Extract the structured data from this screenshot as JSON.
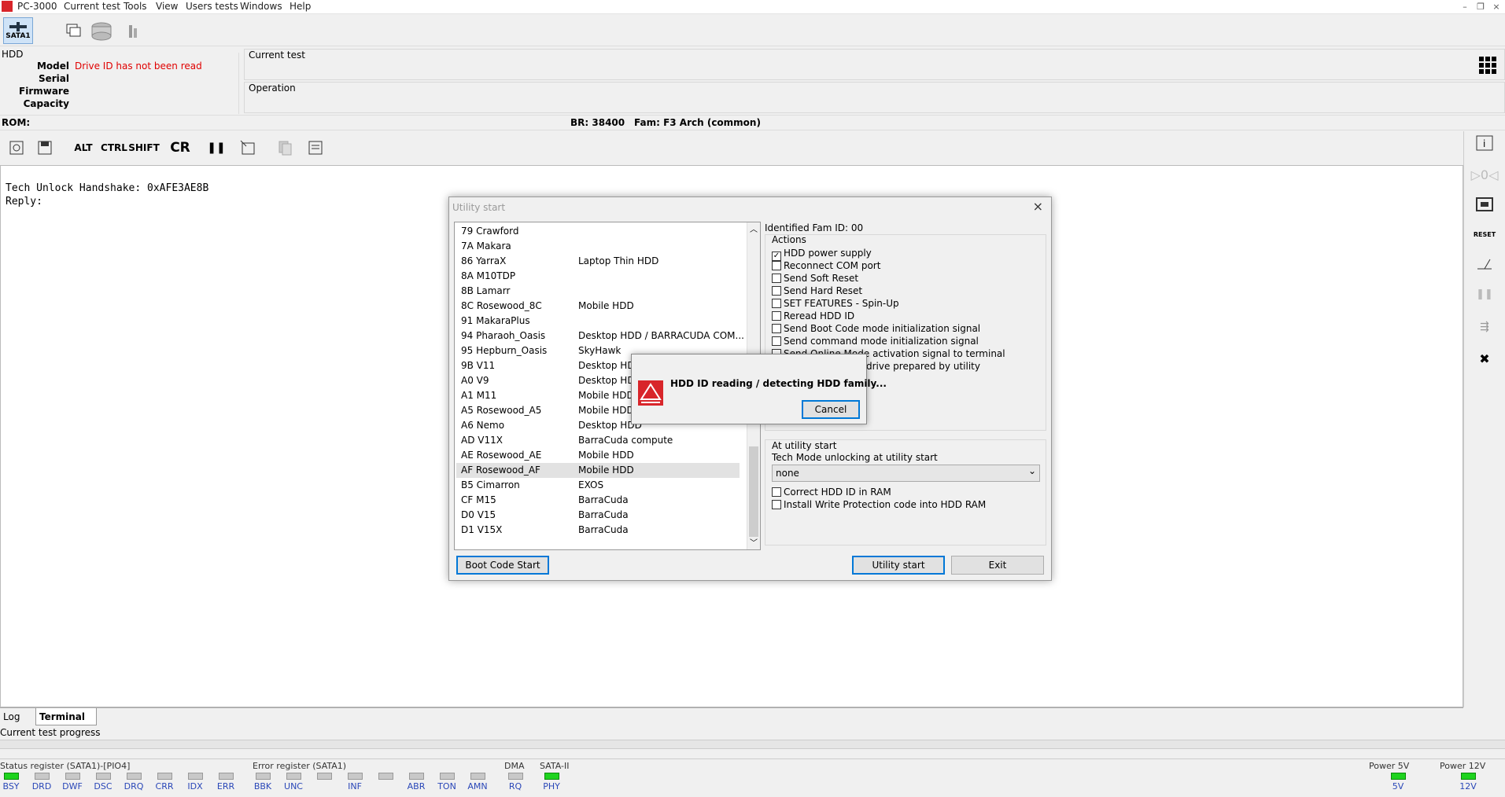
{
  "menubar": {
    "app": "PC-3000",
    "items": [
      "Current test",
      "Tools",
      "View",
      "Users tests",
      "Windows",
      "Help"
    ]
  },
  "toolbar": {
    "port_label": "SATA1"
  },
  "hdd": {
    "panel_title": "HDD",
    "model_label": "Model",
    "model_value": "Drive ID has not been read",
    "serial_label": "Serial",
    "firmware_label": "Firmware",
    "capacity_label": "Capacity"
  },
  "current_test": {
    "label": "Current test",
    "operation_label": "Operation"
  },
  "rombar": {
    "rom": "ROM:",
    "br": "BR: 38400",
    "fam": "Fam: F3 Arch (common)"
  },
  "terminal_toolbar": {
    "alt": "ALT",
    "ctrl": "CTRL",
    "shift": "SHIFT",
    "cr": "CR"
  },
  "terminal": {
    "lines": [
      "Tech Unlock Handshake: 0xAFE3AE8B",
      "Reply:"
    ]
  },
  "tabs": {
    "log": "Log",
    "terminal": "Terminal"
  },
  "progress": {
    "label": "Current test progress"
  },
  "status": {
    "status_register": {
      "title": "Status register (SATA1)-[PIO4]",
      "leds": [
        {
          "name": "BSY",
          "on": true
        },
        {
          "name": "DRD",
          "on": false
        },
        {
          "name": "DWF",
          "on": false
        },
        {
          "name": "DSC",
          "on": false
        },
        {
          "name": "DRQ",
          "on": false
        },
        {
          "name": "CRR",
          "on": false
        },
        {
          "name": "IDX",
          "on": false
        },
        {
          "name": "ERR",
          "on": false
        }
      ]
    },
    "error_register": {
      "title": "Error register (SATA1)",
      "leds": [
        {
          "name": "BBK",
          "on": false
        },
        {
          "name": "UNC",
          "on": false
        },
        {
          "name": "",
          "on": false
        },
        {
          "name": "INF",
          "on": false
        },
        {
          "name": "",
          "on": false
        },
        {
          "name": "ABR",
          "on": false
        },
        {
          "name": "TON",
          "on": false
        },
        {
          "name": "AMN",
          "on": false
        }
      ]
    },
    "dma": {
      "title": "DMA",
      "leds": [
        {
          "name": "RQ",
          "on": false
        }
      ]
    },
    "sata": {
      "title": "SATA-II",
      "leds": [
        {
          "name": "PHY",
          "on": true
        }
      ]
    },
    "power5": {
      "title": "Power 5V",
      "name": "5V",
      "on": true
    },
    "power12": {
      "title": "Power 12V",
      "name": "12V",
      "on": true
    }
  },
  "dialog": {
    "title": "Utility start",
    "families": [
      {
        "id": "79 Crawford",
        "desc": ""
      },
      {
        "id": "7A Makara",
        "desc": ""
      },
      {
        "id": "86 YarraX",
        "desc": "Laptop Thin HDD"
      },
      {
        "id": "8A M10TDP",
        "desc": ""
      },
      {
        "id": "8B Lamarr",
        "desc": ""
      },
      {
        "id": "8C Rosewood_8C",
        "desc": "Mobile HDD"
      },
      {
        "id": "91 MakaraPlus",
        "desc": ""
      },
      {
        "id": "94 Pharaoh_Oasis",
        "desc": "Desktop HDD / BARRACUDA COM..."
      },
      {
        "id": "95 Hepburn_Oasis",
        "desc": "SkyHawk"
      },
      {
        "id": "9B V11",
        "desc": "Desktop HDD"
      },
      {
        "id": "A0 V9",
        "desc": "Desktop HDD"
      },
      {
        "id": "A1 M11",
        "desc": "Mobile HDD"
      },
      {
        "id": "A5 Rosewood_A5",
        "desc": "Mobile HDD"
      },
      {
        "id": "A6 Nemo",
        "desc": "Desktop HDD"
      },
      {
        "id": "AD V11X",
        "desc": "BarraCuda compute"
      },
      {
        "id": "AE Rosewood_AE",
        "desc": "Mobile HDD"
      },
      {
        "id": "AF Rosewood_AF",
        "desc": "Mobile HDD"
      },
      {
        "id": "B5 Cimarron",
        "desc": "EXOS"
      },
      {
        "id": "CF M15",
        "desc": "BarraCuda"
      },
      {
        "id": "D0 V15",
        "desc": "BarraCuda"
      },
      {
        "id": "D1 V15X",
        "desc": "BarraCuda"
      }
    ],
    "selected_index": 16,
    "identified": "Identified Fam ID: 00",
    "actions_title": "Actions",
    "actions": [
      {
        "label": "HDD power supply",
        "checked": true
      },
      {
        "label": "Reconnect COM port",
        "checked": false
      },
      {
        "label": "Send Soft Reset",
        "checked": false
      },
      {
        "label": "Send Hard Reset",
        "checked": false
      },
      {
        "label": "SET FEATURES - Spin-Up",
        "checked": false
      },
      {
        "label": "Reread HDD ID",
        "checked": false
      },
      {
        "label": "Send Boot Code mode initialization signal",
        "checked": false
      },
      {
        "label": "Send command mode initialization signal",
        "checked": false
      },
      {
        "label": "Send Online Mode activation signal to terminal",
        "checked": false
      },
      {
        "label": "drive prepared by utility",
        "checked": false
      }
    ],
    "at_start_title": "At utility start",
    "tech_mode_label": "Tech Mode unlocking at utility start",
    "tech_mode_value": "none",
    "options": [
      {
        "label": "Correct HDD ID in RAM",
        "checked": false
      },
      {
        "label": "Install Write Protection code into HDD RAM",
        "checked": false
      }
    ],
    "boot_code_btn": "Boot Code Start",
    "utility_start_btn": "Utility start",
    "exit_btn": "Exit"
  },
  "popup": {
    "message": "HDD ID reading / detecting HDD family...",
    "cancel": "Cancel"
  },
  "colors": {
    "led_on": "#1ed31e",
    "error_text": "#e00000",
    "link_blue": "#2a47b8",
    "default_button": "#0078d7"
  }
}
